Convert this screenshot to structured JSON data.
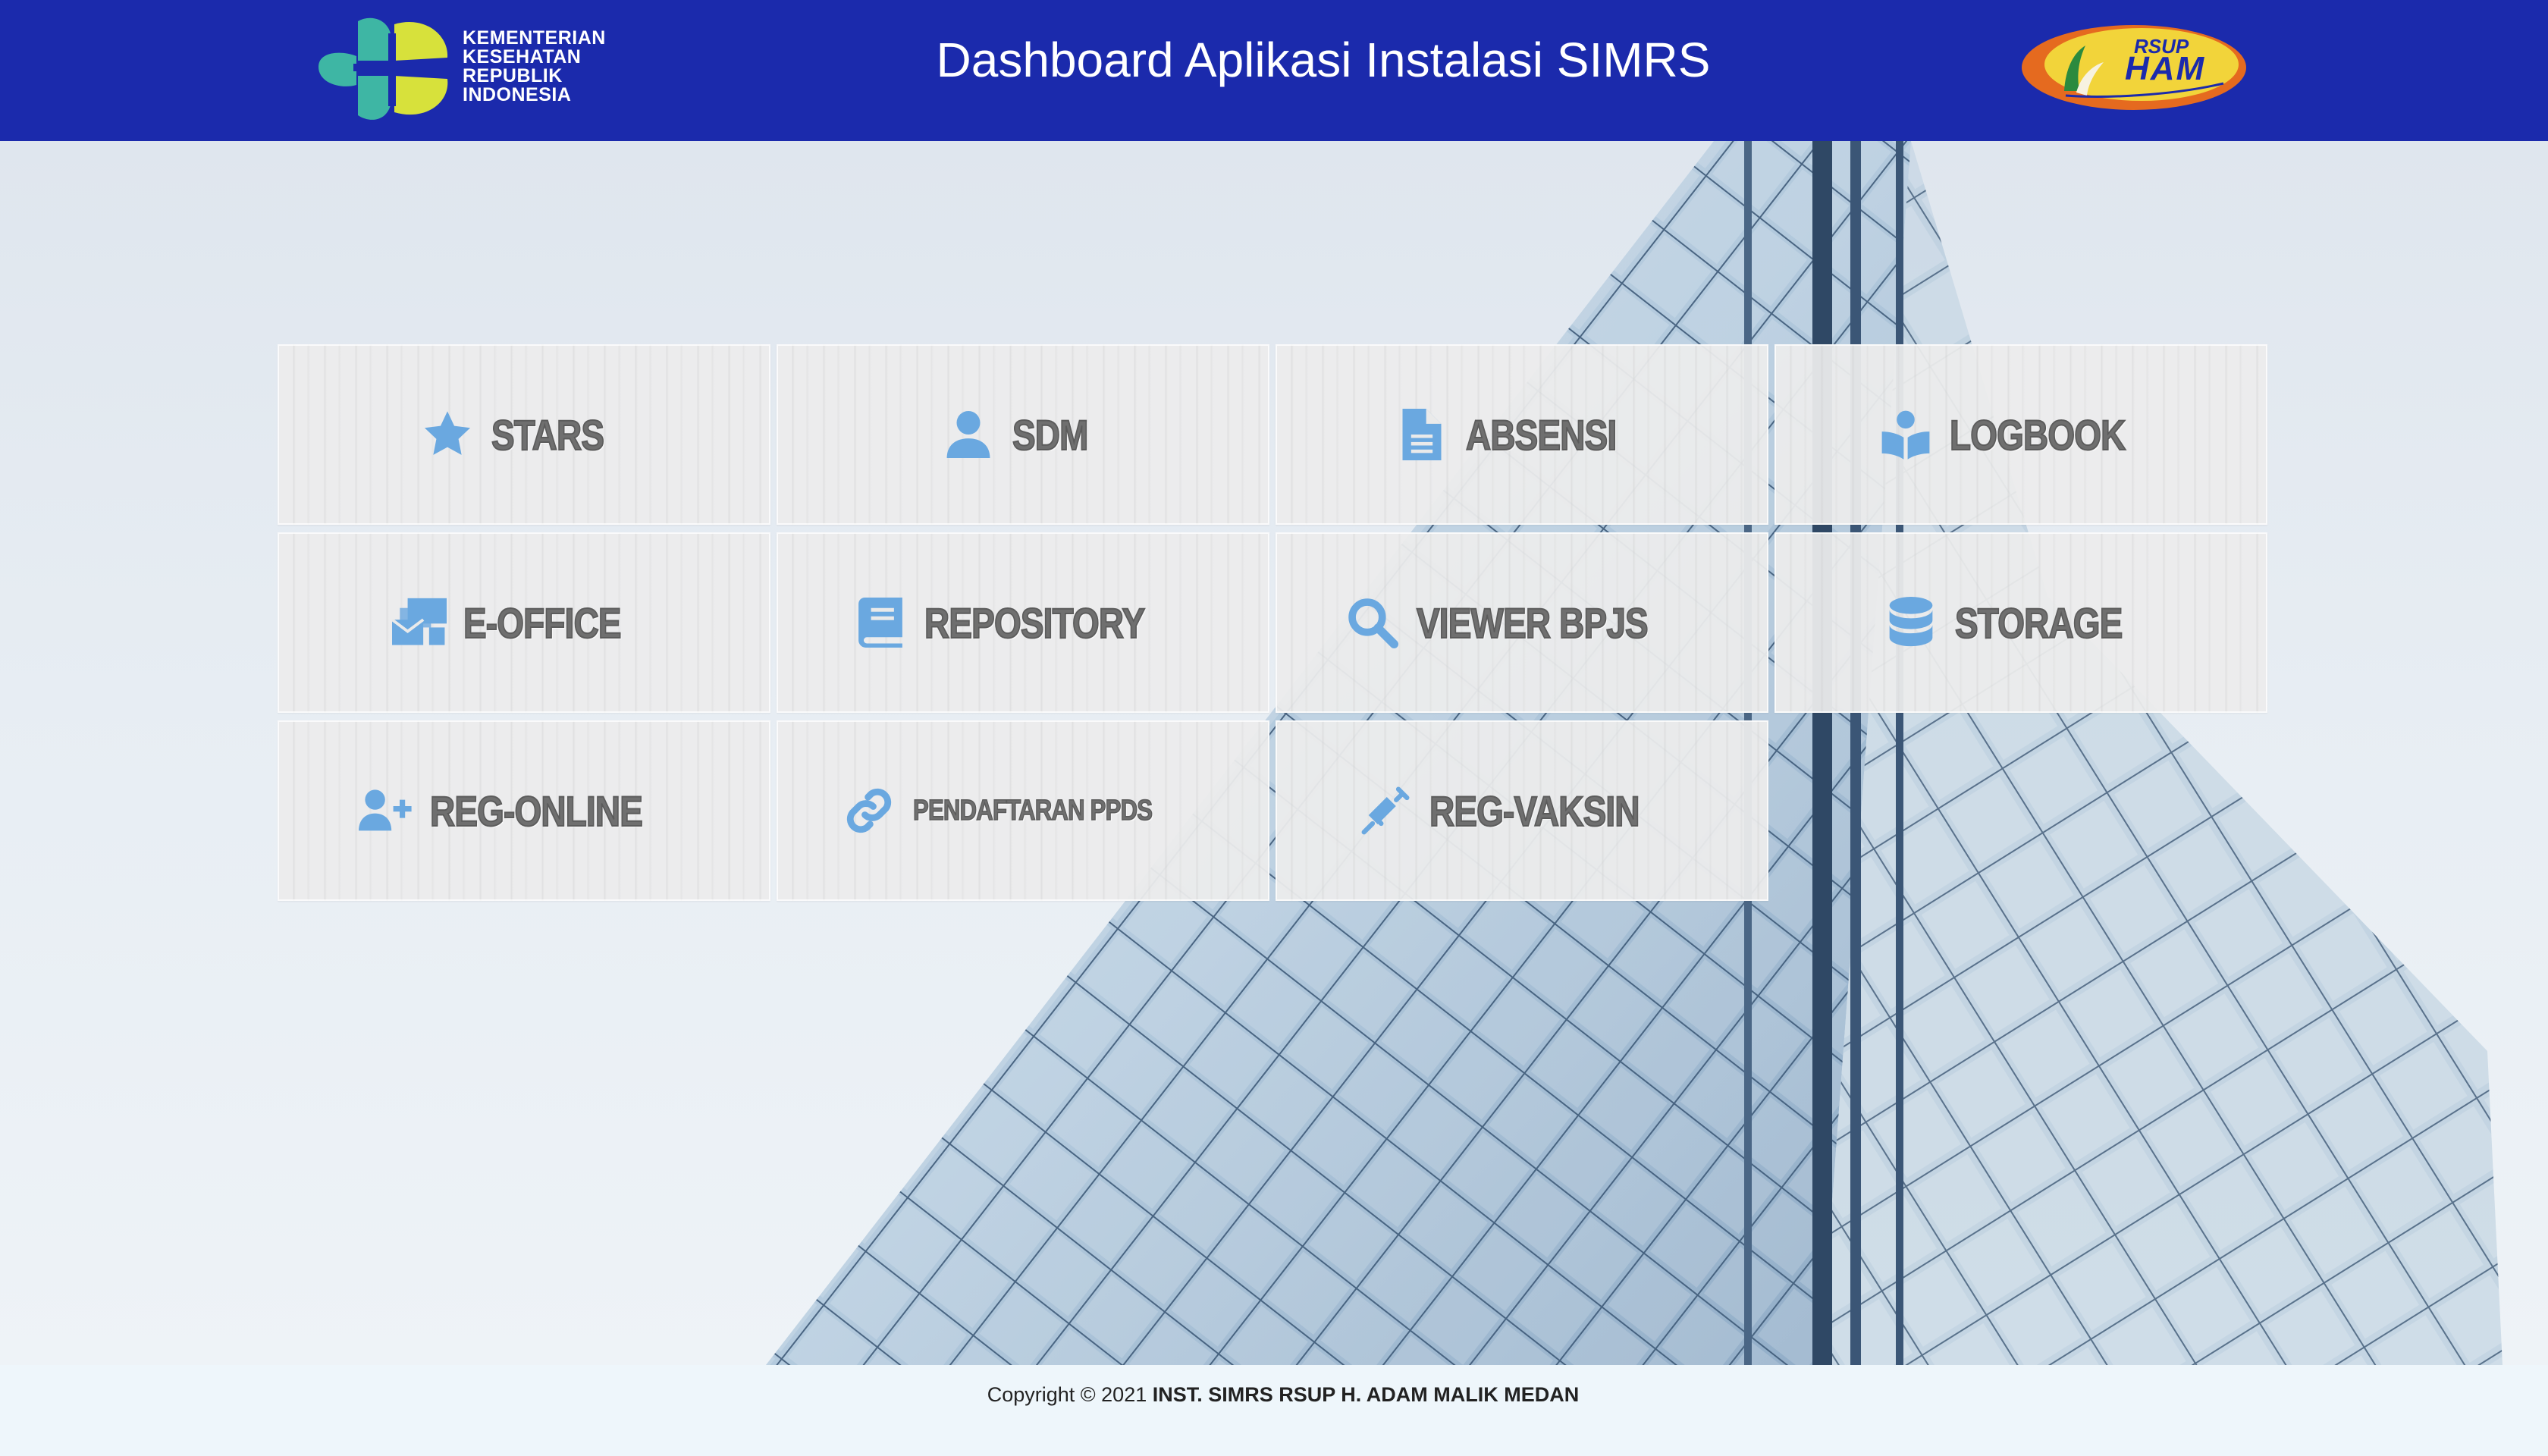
{
  "header": {
    "title": "Dashboard Aplikasi Instalasi SIMRS",
    "left_logo": {
      "lines": [
        "KEMENTERIAN",
        "KESEHATAN",
        "REPUBLIK",
        "INDONESIA"
      ]
    },
    "right_logo": {
      "top": "RSUP",
      "main": "HAM"
    },
    "colors": {
      "header_bg": "#1b2aac",
      "title": "#ffffff"
    }
  },
  "tiles": [
    {
      "label": "STARS",
      "icon": "star-icon"
    },
    {
      "label": "SDM",
      "icon": "user-icon"
    },
    {
      "label": "ABSENSI",
      "icon": "document-icon"
    },
    {
      "label": "LOGBOOK",
      "icon": "book-reader-icon"
    },
    {
      "label": "E-OFFICE",
      "icon": "mail-bulk-icon"
    },
    {
      "label": "REPOSITORY",
      "icon": "book-icon"
    },
    {
      "label": "VIEWER BPJS",
      "icon": "search-icon"
    },
    {
      "label": "STORAGE",
      "icon": "database-icon"
    },
    {
      "label": "REG-ONLINE",
      "icon": "user-plus-icon"
    },
    {
      "label": "PENDAFTARAN PPDS",
      "icon": "link-icon"
    },
    {
      "label": "REG-VAKSIN",
      "icon": "syringe-icon"
    }
  ],
  "tile_colors": {
    "icon": "#6aa8e0",
    "label": "#6f6f6f"
  },
  "footer": {
    "prefix": "Copyright © 2021",
    "owner": "INST. SIMRS RSUP H. ADAM MALIK MEDAN"
  }
}
